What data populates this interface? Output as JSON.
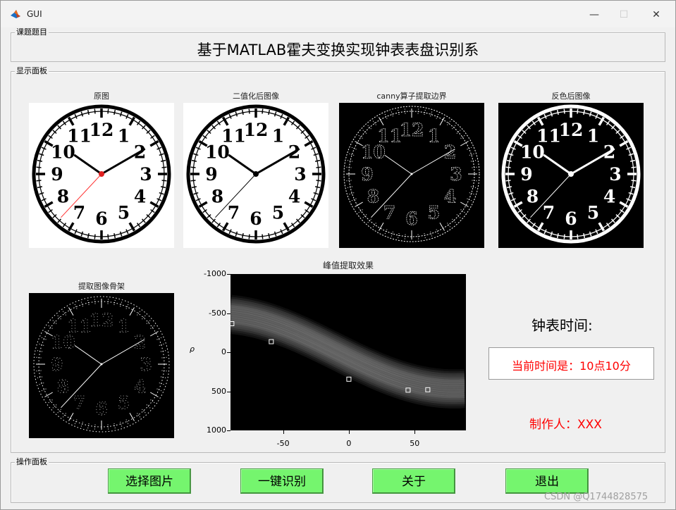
{
  "window": {
    "title": "GUI",
    "minimize": "—",
    "maximize": "☐",
    "close": "✕"
  },
  "topic_panel": {
    "label": "课题题目",
    "title": "基于MATLAB霍夫变换实现钟表表盘识别系"
  },
  "display_panel": {
    "label": "显示面板",
    "images": {
      "original": "原图",
      "binary": "二值化后图像",
      "canny": "canny算子提取边界",
      "inverted": "反色后图像",
      "skeleton": "提取图像骨架"
    },
    "clock_numbers": [
      "12",
      "1",
      "2",
      "3",
      "4",
      "5",
      "6",
      "7",
      "8",
      "9",
      "10",
      "11"
    ],
    "time_label": "钟表时间:",
    "time_value": "当前时间是：10点10分",
    "author": "制作人：XXX"
  },
  "chart_data": {
    "type": "scatter",
    "title": "峰值提取效果",
    "xlabel": "",
    "ylabel": "ρ",
    "xlim": [
      -90,
      89
    ],
    "ylim": [
      -1000,
      1000
    ],
    "y_reversed": true,
    "x_ticks": [
      -50,
      0,
      50
    ],
    "x_tick_labels": [
      "-50",
      "0",
      "50"
    ],
    "y_ticks": [
      -1000,
      -500,
      0,
      500,
      1000
    ],
    "y_tick_labels": [
      "-1000",
      "-500",
      "0",
      "500",
      "1000"
    ],
    "background": "#000000",
    "peak_color": "#ffffff",
    "points": [
      {
        "x": -89,
        "y": -365
      },
      {
        "x": -59,
        "y": -135
      },
      {
        "x": 0,
        "y": 345
      },
      {
        "x": 45,
        "y": 485
      },
      {
        "x": 60,
        "y": 480
      }
    ]
  },
  "action_panel": {
    "label": "操作面板",
    "buttons": {
      "select": "选择图片",
      "recognize": "一键识别",
      "about": "关于",
      "exit": "退出"
    }
  },
  "watermark": "CSDN @Q1744828575",
  "colors": {
    "button_green": "#75f56e",
    "red_text": "#ff0000",
    "panel_bg": "#f0f0f0"
  }
}
